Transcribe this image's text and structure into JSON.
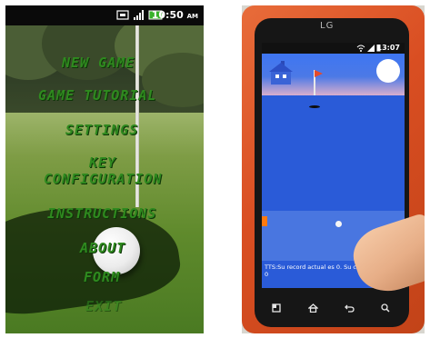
{
  "left_screen": {
    "status_bar": {
      "time": "10:50",
      "ampm": "AM"
    },
    "menu": [
      "NEW GAME",
      "GAME TUTORIAL",
      "SETTINGS",
      "KEY",
      "CONFIGURATION",
      "INSTRUCTIONS",
      "ABOUT",
      "FORM",
      "EXIT"
    ]
  },
  "right_phone": {
    "brand_logo": "LG",
    "status_bar": {
      "time": "13:07"
    },
    "tts_message": [
      "TTS:Su record actual es 0. Su contador actu...",
      "0"
    ],
    "nav_icons": [
      "menu-icon",
      "home-icon",
      "back-icon",
      "search-icon"
    ],
    "colors": {
      "screen_blue": "#2a5bd8",
      "menu_green": "#2f8a1f",
      "phone_case": "#d94e22",
      "flag": "#e54b2a"
    }
  }
}
